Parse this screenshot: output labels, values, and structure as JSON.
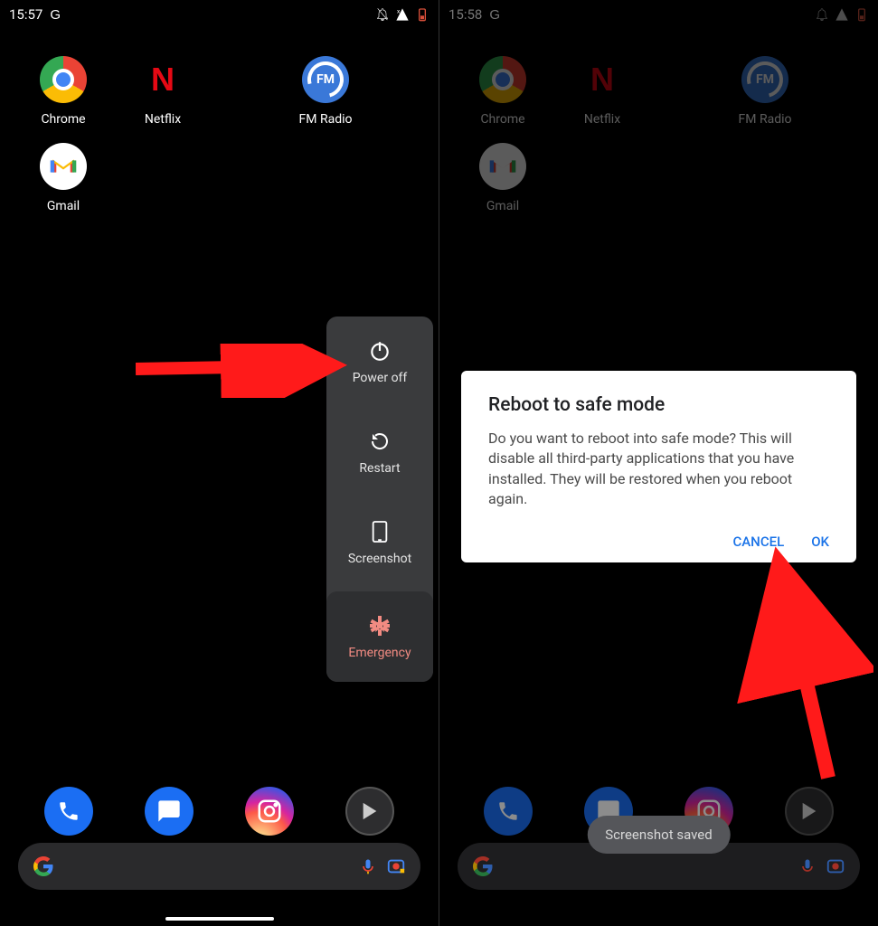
{
  "left": {
    "time": "15:57",
    "g": "G",
    "apps": [
      {
        "name": "chrome",
        "label": "Chrome"
      },
      {
        "name": "netflix",
        "label": "Netflix"
      },
      {
        "name": "fmradio",
        "label": "FM Radio"
      },
      {
        "name": "gmail",
        "label": "Gmail"
      }
    ],
    "power": [
      {
        "name": "power-off",
        "label": "Power off"
      },
      {
        "name": "restart",
        "label": "Restart"
      },
      {
        "name": "screenshot",
        "label": "Screenshot"
      },
      {
        "name": "emergency",
        "label": "Emergency"
      }
    ]
  },
  "right": {
    "time": "15:58",
    "g": "G",
    "apps": [
      {
        "name": "chrome",
        "label": "Chrome"
      },
      {
        "name": "netflix",
        "label": "Netflix"
      },
      {
        "name": "fmradio",
        "label": "FM Radio"
      },
      {
        "name": "gmail",
        "label": "Gmail"
      }
    ],
    "dialog": {
      "title": "Reboot to safe mode",
      "body": "Do you want to reboot into safe mode? This will disable all third-party applications that you have installed. They will be restored when you reboot again.",
      "cancel": "CANCEL",
      "ok": "OK"
    },
    "toast": "Screenshot saved"
  },
  "icons": {
    "g": "G",
    "n": "N",
    "fm": "FM",
    "mic": "mic",
    "lens": "lens"
  }
}
